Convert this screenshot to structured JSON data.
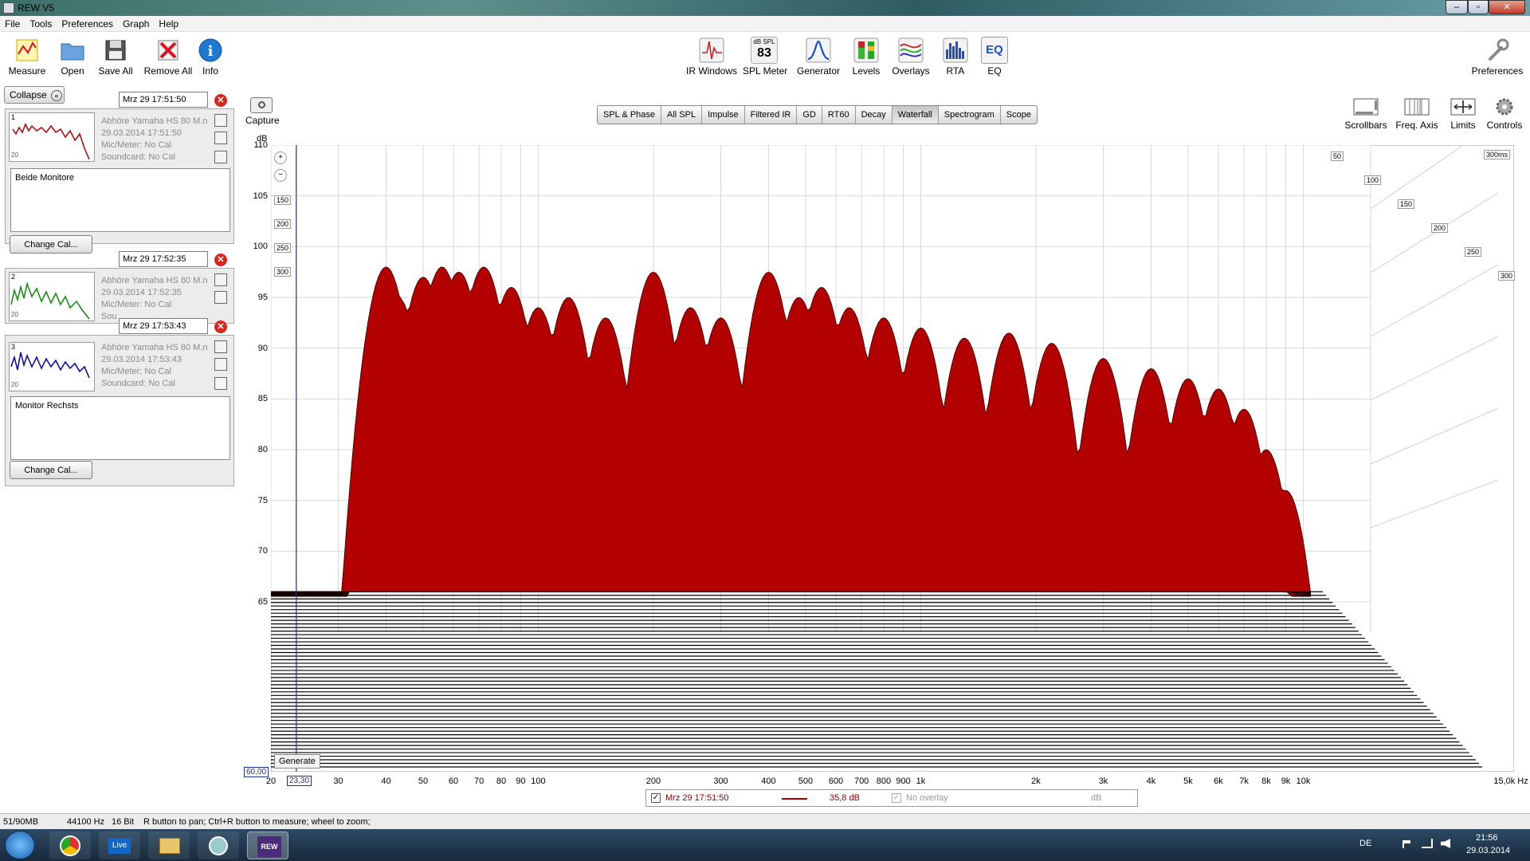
{
  "window": {
    "title": "REW V5"
  },
  "menu": [
    "File",
    "Tools",
    "Preferences",
    "Graph",
    "Help"
  ],
  "toolbar_left": [
    {
      "label": "Measure",
      "icon": "measure-icon"
    },
    {
      "label": "Open",
      "icon": "folder-icon"
    },
    {
      "label": "Save All",
      "icon": "save-icon"
    },
    {
      "label": "Remove All",
      "icon": "remove-icon"
    },
    {
      "label": "Info",
      "icon": "info-icon"
    }
  ],
  "toolbar_center": [
    {
      "label": "IR Windows",
      "icon": "ir-windows-icon"
    },
    {
      "label": "SPL Meter",
      "icon": "spl-meter-icon",
      "caption": "dB SPL",
      "value": "83"
    },
    {
      "label": "Generator",
      "icon": "generator-icon"
    },
    {
      "label": "Levels",
      "icon": "levels-icon"
    },
    {
      "label": "Overlays",
      "icon": "overlays-icon"
    },
    {
      "label": "RTA",
      "icon": "rta-icon"
    },
    {
      "label": "EQ",
      "icon": "eq-icon",
      "caption": "EQ"
    }
  ],
  "toolbar_right": {
    "label": "Preferences",
    "icon": "wrench-icon"
  },
  "collapse_label": "Collapse",
  "measurements": [
    {
      "num": "1",
      "name": "Mrz 29 17:51:50",
      "desc": "Abhöre Yamaha HS 80 M.n",
      "date": "29.03.2014 17:51:50",
      "mic": "Mic/Meter: No Cal",
      "soundcard": "Soundcard: No Cal",
      "notes": "Beide Monitore",
      "color": "#b30000",
      "button": "Change Cal...",
      "thumb_label": "20"
    },
    {
      "num": "2",
      "name": "Mrz 29 17:52:35",
      "desc": "Abhöre Yamaha HS 80 M.n",
      "date": "29.03.2014 17:52:35",
      "mic": "Mic/Meter: No Cal",
      "soundcard": "Sou",
      "notes": "",
      "color": "#0a8a0a",
      "button": "",
      "thumb_label": "20"
    },
    {
      "num": "3",
      "name": "Mrz 29 17:53:43",
      "desc": "Abhöre Yamaha HS 80 M.n",
      "date": "29.03.2014 17:53:43",
      "mic": "Mic/Meter: No Cal",
      "soundcard": "Soundcard: No Cal",
      "notes": "Monitor Rechsts",
      "color": "#0000b0",
      "button": "Change Cal...",
      "thumb_label": "20"
    }
  ],
  "capture_label": "Capture",
  "tabs": [
    {
      "label": "SPL & Phase",
      "active": false
    },
    {
      "label": "All SPL",
      "active": false
    },
    {
      "label": "Impulse",
      "active": false
    },
    {
      "label": "Filtered IR",
      "active": false
    },
    {
      "label": "GD",
      "active": false
    },
    {
      "label": "RT60",
      "active": false
    },
    {
      "label": "Decay",
      "active": false
    },
    {
      "label": "Waterfall",
      "active": true
    },
    {
      "label": "Spectrogram",
      "active": false
    },
    {
      "label": "Scope",
      "active": false
    }
  ],
  "right_tools": [
    {
      "label": "Scrollbars",
      "icon": "scrollbars-icon"
    },
    {
      "label": "Freq. Axis",
      "icon": "freq-axis-icon"
    },
    {
      "label": "Limits",
      "icon": "limits-icon"
    },
    {
      "label": "Controls",
      "icon": "gear-icon"
    }
  ],
  "chart_data": {
    "type": "area",
    "ylabel": "dB",
    "y_ticks": [
      "110",
      "105",
      "100",
      "95",
      "90",
      "85",
      "80",
      "75",
      "70",
      "65"
    ],
    "x_ticks": [
      "20",
      "30",
      "40",
      "50",
      "60",
      "70",
      "80",
      "90",
      "100",
      "200",
      "300",
      "400",
      "500",
      "600",
      "700",
      "800",
      "900",
      "1k",
      "2k",
      "3k",
      "4k",
      "5k",
      "6k",
      "7k",
      "8k",
      "9k",
      "10k",
      "15,0k Hz"
    ],
    "z_ticks_left": [
      "150",
      "200",
      "250",
      "300"
    ],
    "z_ticks_right": [
      "50",
      "100",
      "150",
      "200",
      "250",
      "300",
      "300ms"
    ],
    "cursor_x": "23,30",
    "cursor_y": "60,00",
    "generate_label": "Generate",
    "fill_color": "#b30000"
  },
  "legend": {
    "name": "Mrz 29 17:51:50",
    "value": "35,8 dB",
    "overlay": "No overlay",
    "unit": "dB",
    "color": "#a00000"
  },
  "status": {
    "memory": "51/90MB",
    "rate": "44100 Hz",
    "bits": "16 Bit",
    "hint": "R button to pan; Ctrl+R button to measure; wheel to zoom;"
  },
  "taskbar": {
    "lang": "DE",
    "time": "21:56",
    "date": "29.03.2014",
    "live_label": "Live"
  }
}
